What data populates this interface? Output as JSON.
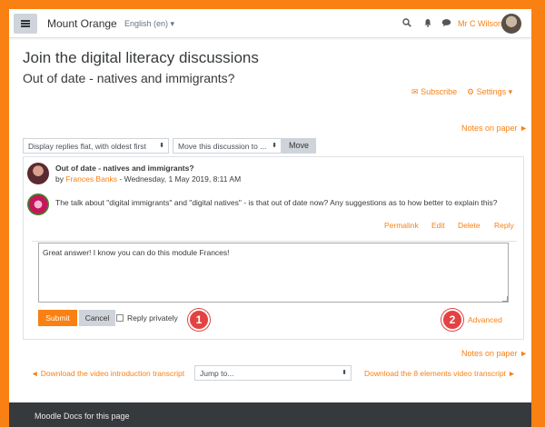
{
  "navbar": {
    "site_name": "Mount Orange",
    "language": "English (en)",
    "user_name": "Mr C Wilson",
    "icons": [
      "search-icon",
      "bell-icon",
      "chat-icon"
    ]
  },
  "page": {
    "title": "Join the digital literacy discussions",
    "subtitle": "Out of date - natives and immigrants?",
    "subscribe_label": "Subscribe",
    "settings_label": "Settings",
    "notes_label": "Notes on paper"
  },
  "controls": {
    "display_mode": "Display replies flat, with oldest first",
    "move_select": "Move this discussion to ...",
    "move_button": "Move"
  },
  "post": {
    "subject": "Out of date - natives and immigrants?",
    "by": "by",
    "author": "Frances Banks",
    "date": "- Wednesday, 1 May 2019, 8:11 AM",
    "body": "The talk about \"digital immigrants\" and \"digital natives\" - is that out of date now? Any suggestions as to how better to explain this?",
    "actions": [
      "Permalink",
      "Edit",
      "Delete",
      "Reply"
    ]
  },
  "reply": {
    "text": "Great answer! I know you can do this module Frances!",
    "submit_label": "Submit",
    "cancel_label": "Cancel",
    "privately_label": "Reply privately",
    "advanced_label": "Advanced",
    "badges": [
      "1",
      "2"
    ]
  },
  "footer_nav": {
    "prev_link": "◄ Download the video introduction transcript",
    "jump_select": "Jump to...",
    "next_link": "Download the 8 elements video transcript ►"
  },
  "footer": {
    "text": "Moodle Docs for this page"
  },
  "colors": {
    "accent": "#f98012",
    "badge": "#e34242",
    "footer_bg": "#373a3c"
  }
}
